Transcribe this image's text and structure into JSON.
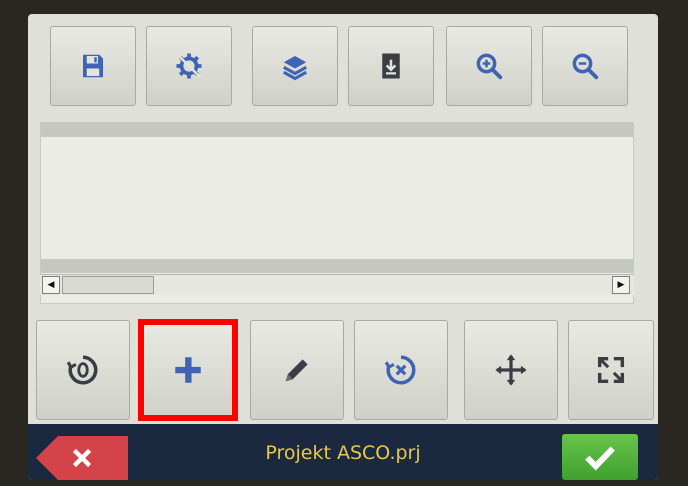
{
  "footer": {
    "title": "Projekt ASCO.prj"
  },
  "colors": {
    "icon_blue": "#3f63b5",
    "icon_dark": "#3b3d44",
    "highlight": "#ff0000",
    "footer_bg": "#1a2940",
    "title_yellow": "#e8c844",
    "cancel_red": "#d5434a",
    "confirm_green": "#4fb23a"
  },
  "toolbar_icons": [
    "save-icon",
    "settings-cog-icon",
    "layers-icon",
    "export-icon",
    "zoom-in-icon",
    "zoom-out-icon"
  ],
  "bottom_icons": [
    "reset-origin-icon",
    "plus-icon",
    "pencil-icon",
    "delete-icon",
    "move-icon",
    "resize-icon"
  ]
}
